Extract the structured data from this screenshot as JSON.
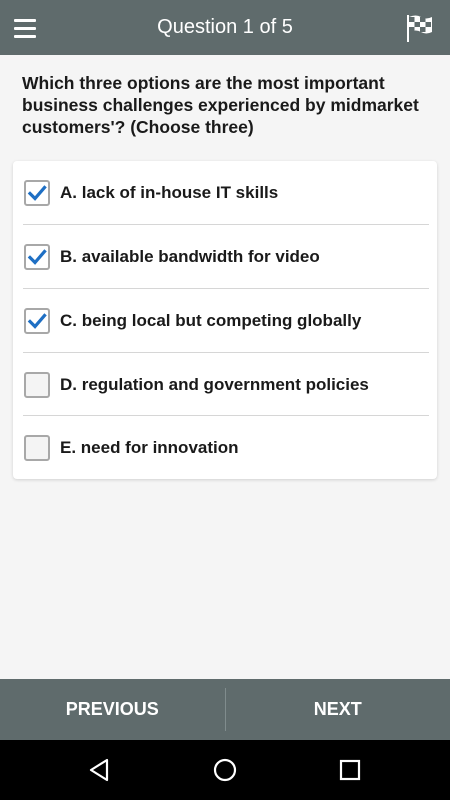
{
  "header": {
    "title": "Question 1 of 5",
    "menu_icon": "hamburger-menu-icon",
    "flag_icon": "checkered-flag-icon"
  },
  "question": {
    "text": "Which three options are the most important business challenges experienced by midmarket customers'? (Choose three)"
  },
  "options": [
    {
      "label": "A. lack of in-house IT skills",
      "checked": true
    },
    {
      "label": "B. available bandwidth for video",
      "checked": true
    },
    {
      "label": "C. being local but competing globally",
      "checked": true
    },
    {
      "label": "D. regulation and government policies",
      "checked": false
    },
    {
      "label": "E. need for innovation",
      "checked": false
    }
  ],
  "navigation": {
    "previous_label": "PREVIOUS",
    "next_label": "NEXT"
  },
  "system_nav": {
    "back_icon": "back-triangle-icon",
    "home_icon": "home-circle-icon",
    "recents_icon": "recents-square-icon"
  },
  "colors": {
    "header_bg": "#5f6b6c",
    "check_blue": "#1e6fc4",
    "page_bg": "#f5f5f5"
  }
}
